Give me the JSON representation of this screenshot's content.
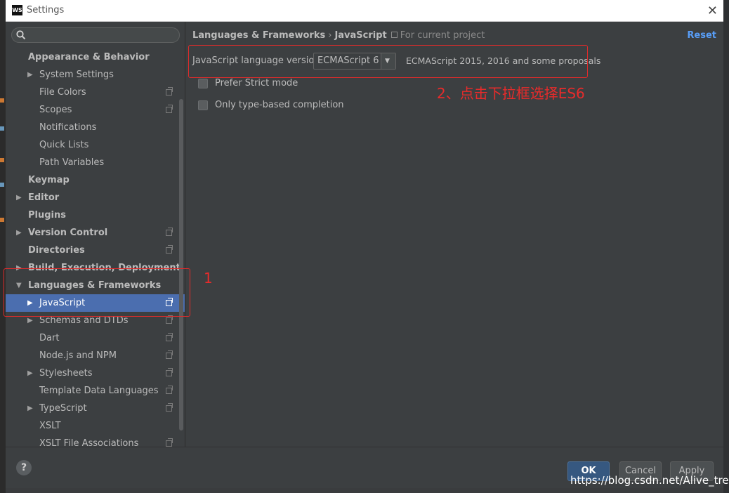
{
  "window": {
    "title": "Settings",
    "app_icon_text": "WS"
  },
  "search": {
    "placeholder": ""
  },
  "sidebar": {
    "items": [
      {
        "label": "Appearance & Behavior",
        "level": 0,
        "bold": true,
        "arrow": "",
        "selected": false,
        "project": false
      },
      {
        "label": "System Settings",
        "level": 1,
        "bold": false,
        "arrow": "▶",
        "selected": false,
        "project": false
      },
      {
        "label": "File Colors",
        "level": 1,
        "bold": false,
        "arrow": "",
        "selected": false,
        "project": true
      },
      {
        "label": "Scopes",
        "level": 1,
        "bold": false,
        "arrow": "",
        "selected": false,
        "project": true
      },
      {
        "label": "Notifications",
        "level": 1,
        "bold": false,
        "arrow": "",
        "selected": false,
        "project": false
      },
      {
        "label": "Quick Lists",
        "level": 1,
        "bold": false,
        "arrow": "",
        "selected": false,
        "project": false
      },
      {
        "label": "Path Variables",
        "level": 1,
        "bold": false,
        "arrow": "",
        "selected": false,
        "project": false
      },
      {
        "label": "Keymap",
        "level": 0,
        "bold": true,
        "arrow": "",
        "selected": false,
        "project": false
      },
      {
        "label": "Editor",
        "level": 0,
        "bold": true,
        "arrow": "▶",
        "selected": false,
        "project": false
      },
      {
        "label": "Plugins",
        "level": 0,
        "bold": true,
        "arrow": "",
        "selected": false,
        "project": false
      },
      {
        "label": "Version Control",
        "level": 0,
        "bold": true,
        "arrow": "▶",
        "selected": false,
        "project": true
      },
      {
        "label": "Directories",
        "level": 0,
        "bold": true,
        "arrow": "",
        "selected": false,
        "project": true
      },
      {
        "label": "Build, Execution, Deployment",
        "level": 0,
        "bold": true,
        "arrow": "▶",
        "selected": false,
        "project": false
      },
      {
        "label": "Languages & Frameworks",
        "level": 0,
        "bold": true,
        "arrow": "▼",
        "selected": false,
        "project": false
      },
      {
        "label": "JavaScript",
        "level": 1,
        "bold": false,
        "arrow": "▶",
        "selected": true,
        "project": true
      },
      {
        "label": "Schemas and DTDs",
        "level": 1,
        "bold": false,
        "arrow": "▶",
        "selected": false,
        "project": true
      },
      {
        "label": "Dart",
        "level": 1,
        "bold": false,
        "arrow": "",
        "selected": false,
        "project": true
      },
      {
        "label": "Node.js and NPM",
        "level": 1,
        "bold": false,
        "arrow": "",
        "selected": false,
        "project": true
      },
      {
        "label": "Stylesheets",
        "level": 1,
        "bold": false,
        "arrow": "▶",
        "selected": false,
        "project": true
      },
      {
        "label": "Template Data Languages",
        "level": 1,
        "bold": false,
        "arrow": "",
        "selected": false,
        "project": true
      },
      {
        "label": "TypeScript",
        "level": 1,
        "bold": false,
        "arrow": "▶",
        "selected": false,
        "project": true
      },
      {
        "label": "XSLT",
        "level": 1,
        "bold": false,
        "arrow": "",
        "selected": false,
        "project": false
      },
      {
        "label": "XSLT File Associations",
        "level": 1,
        "bold": false,
        "arrow": "",
        "selected": false,
        "project": true
      }
    ]
  },
  "content": {
    "breadcrumb": [
      "Languages & Frameworks",
      "JavaScript"
    ],
    "breadcrumb_sep": "›",
    "scope": "For current project",
    "reset": "Reset",
    "language_version": {
      "label": "JavaScript language version",
      "value": "ECMAScript 6",
      "description": "ECMAScript 2015, 2016 and some proposals"
    },
    "prefer_strict": {
      "label": "Prefer Strict mode",
      "checked": false
    },
    "type_based": {
      "label": "Only type-based completion",
      "checked": false
    }
  },
  "annotations": {
    "step1": "1",
    "step2": "2、点击下拉框选择ES6",
    "color": "#e02b2b"
  },
  "footer": {
    "help": "?",
    "ok": "OK",
    "cancel": "Cancel",
    "apply": "Apply"
  },
  "watermark": "https://blog.csdn.net/Alive_tree",
  "colors": {
    "selection": "#4b6eaf",
    "link": "#589df6",
    "primary_button": "#365880"
  }
}
